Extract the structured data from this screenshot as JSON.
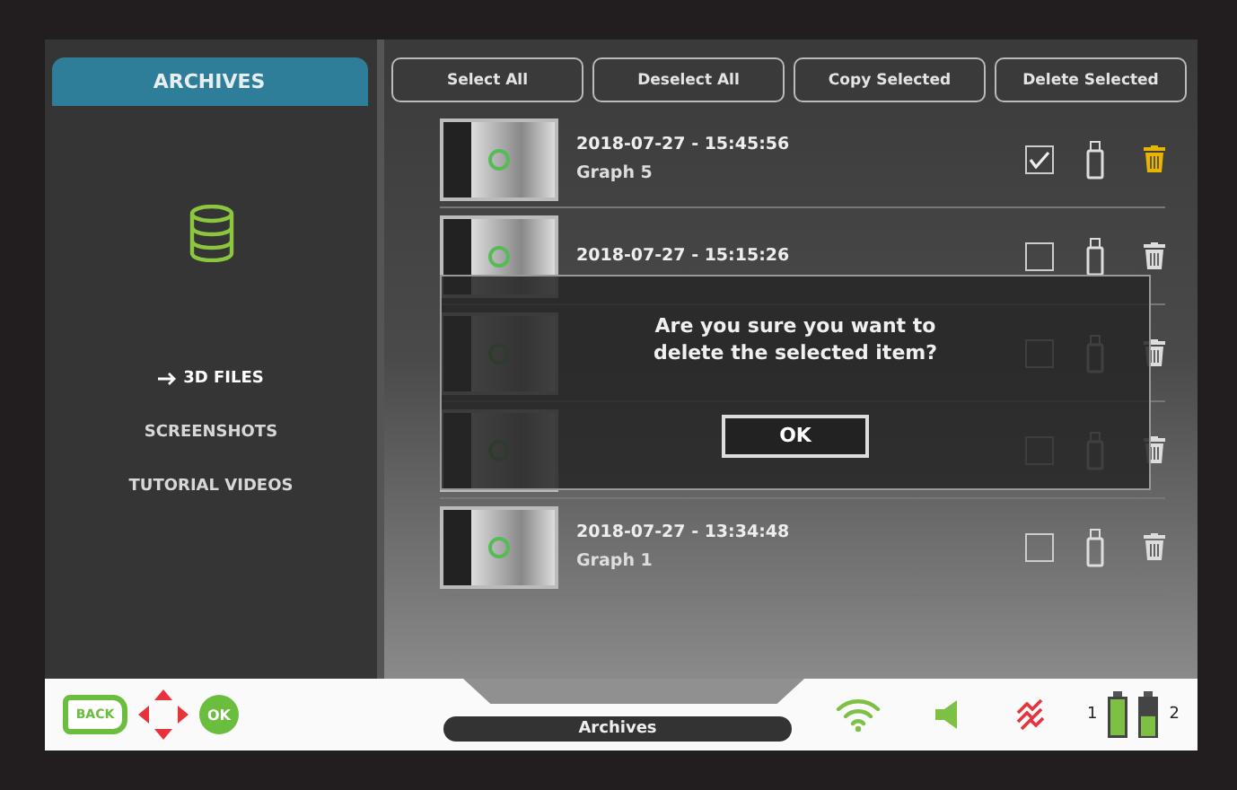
{
  "sidebar": {
    "title": "ARCHIVES",
    "items": [
      {
        "label": "3D FILES",
        "selected": true
      },
      {
        "label": "SCREENSHOTS",
        "selected": false
      },
      {
        "label": "TUTORIAL VIDEOS",
        "selected": false
      }
    ]
  },
  "toolbar": [
    "Select All",
    "Deselect All",
    "Copy Selected",
    "Delete Selected"
  ],
  "files": [
    {
      "timestamp": "2018-07-27 - 15:45:56",
      "name": "Graph 5",
      "checked": true
    },
    {
      "timestamp": "2018-07-27 - 15:15:26",
      "checked": false
    },
    {
      "checked": false
    },
    {
      "checked": false
    },
    {
      "timestamp": "2018-07-27 - 13:34:48",
      "name": "Graph 1",
      "checked": false
    }
  ],
  "dialog": {
    "message": "Are you sure you want to delete the selected item?",
    "button": "OK"
  },
  "footer": {
    "back": "BACK",
    "ok": "OK",
    "title": "Archives",
    "batteries": [
      "1",
      "2"
    ]
  }
}
